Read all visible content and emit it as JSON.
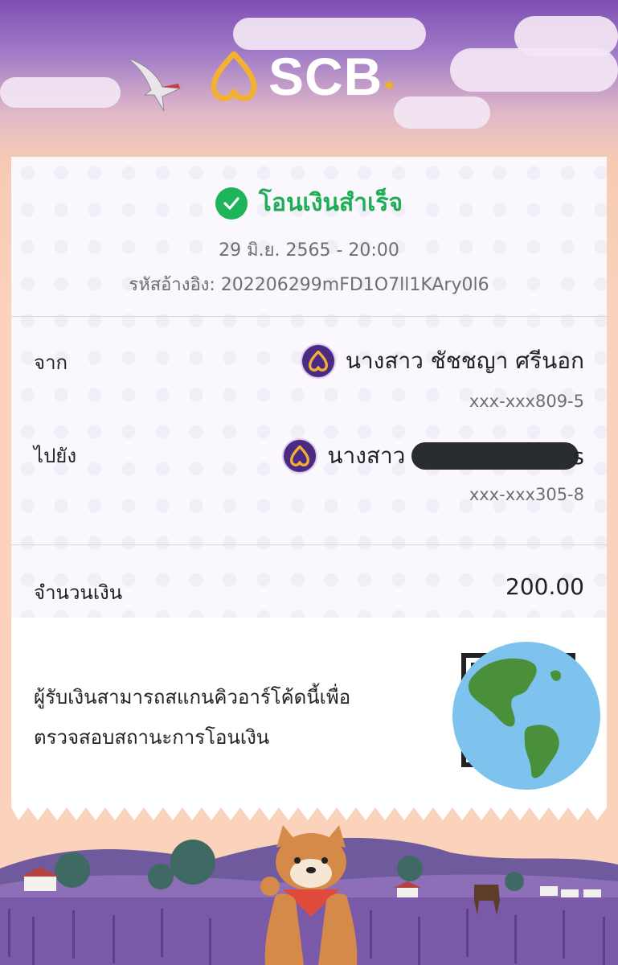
{
  "header": {
    "logo_text": "SCB",
    "sparkle": "*",
    "logo_color": "#f2b134",
    "bank_icon": "scb-bell-logo-icon"
  },
  "status": {
    "title": "โอนเงินสำเร็จ",
    "icon": "check-circle-icon",
    "color": "#1db45a"
  },
  "transaction": {
    "datetime": "29 มิ.ย. 2565 - 20:00",
    "reference": "รหัสอ้างอิง: 202206299mFD1O7ll1KAry0l6"
  },
  "from": {
    "label": "จาก",
    "name": "นางสาว ชัชชญา ศรีนอก",
    "account": "xxx-xxx809-5"
  },
  "to": {
    "label": "ไปยัง",
    "name": "นางสาว",
    "name_suffix": "s",
    "account": "xxx-xxx305-8"
  },
  "amount": {
    "label": "จำนวนเงิน",
    "value": "200.00"
  },
  "qr_note": {
    "line1": "ผู้รับเงินสามารถสแกนคิวอาร์โค้ดนี้เพื่อ",
    "line2": "ตรวจสอบสถานะการโอนเงิน"
  },
  "colors": {
    "brand_purple": "#4b2a82",
    "success_green": "#1db45a",
    "sky_top": "#7e4fb3",
    "peach": "#fbd3bc"
  }
}
